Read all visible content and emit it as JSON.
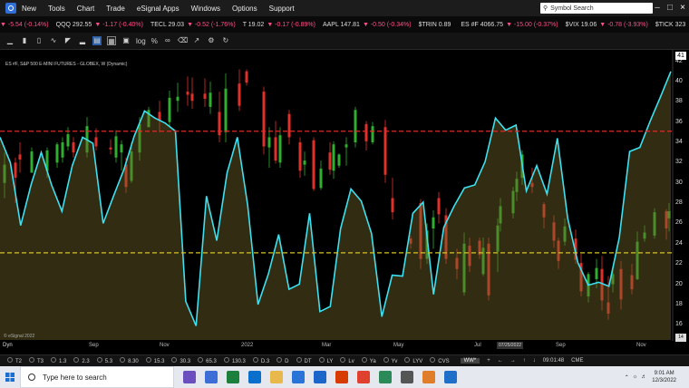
{
  "menubar": {
    "items": [
      "New",
      "Tools",
      "Chart",
      "Trade",
      "eSignal Apps",
      "Windows",
      "Options",
      "Support"
    ],
    "search_placeholder": "Symbol Search"
  },
  "ticker": [
    {
      "sym": "",
      "last": "",
      "chg": "▼ -5.54 (-0.14%)",
      "dir": "neg"
    },
    {
      "sym": "QQQ",
      "last": "292.55",
      "chg": "▼ -1.17 (-0.40%)",
      "dir": "neg"
    },
    {
      "sym": "TECL",
      "last": "29.03",
      "chg": "▼ -0.52 (-1.76%)",
      "dir": "neg"
    },
    {
      "sym": "T",
      "last": "19.02",
      "chg": "▼ -0.17 (-0.89%)",
      "dir": "neg"
    },
    {
      "sym": "AAPL",
      "last": "147.81",
      "chg": "▼ -0.50 (-0.34%)",
      "dir": "neg"
    },
    {
      "sym": "$TRIN",
      "last": "0.89",
      "chg": "",
      "dir": "neg"
    },
    {
      "sym": "ES #F",
      "last": "4066.75",
      "chg": "▼ -15.00 (-0.37%)",
      "dir": "neg"
    },
    {
      "sym": "$VIX",
      "last": "19.06",
      "chg": "▼ -0.78 (-3.93%)",
      "dir": "neg"
    },
    {
      "sym": "$TICK",
      "last": "323",
      "chg": "",
      "dir": "pos"
    },
    {
      "sym": "GUT",
      "last": "7.4",
      "chg": "",
      "dir": "pos"
    }
  ],
  "toolbar": {
    "log_label": "log",
    "pct_label": "%"
  },
  "chart": {
    "title": "ES #F, S&P 500 E-MINI FUTURES - GLOBEX, W (Dynamic)",
    "copyright": "© eSignal 2022",
    "y_ticks": [
      "42",
      "40",
      "38",
      "36",
      "34",
      "32",
      "30",
      "28",
      "26",
      "24",
      "22",
      "20",
      "18",
      "16"
    ],
    "x_labels": [
      "Sep",
      "Nov",
      "2022",
      "Mar",
      "May",
      "Jul",
      "Sep",
      "Nov"
    ],
    "date_tag": "07/25/2022",
    "yval_tag": "41",
    "small_tag": "14",
    "dyn_label": "Dyn",
    "colors": {
      "line": "#3ee0f0",
      "up": "#2fae2f",
      "down": "#e0302a",
      "red_level": "#e02a2a",
      "yellow_level": "#d4c22a"
    }
  },
  "chart_data": {
    "type": "line",
    "ylim": [
      14.5,
      42.5
    ],
    "levels": [
      35.1,
      23.1
    ],
    "cyan_line": [
      34.5,
      32,
      25.8,
      29.8,
      33,
      29.8,
      27.2,
      31.7,
      34.5,
      33.9,
      26,
      28.7,
      31.3,
      34.6,
      37.1,
      36.4,
      35.9,
      35.1,
      18.3,
      15.9,
      28.7,
      24.3,
      31,
      34.5,
      27.8,
      18,
      21,
      24.9,
      19.5,
      20,
      27,
      17.3,
      17.8,
      25.5,
      29.4,
      28.2,
      25,
      16.8,
      20.9,
      20.8,
      27,
      28.1,
      19,
      25.6,
      27.7,
      29.5,
      29.8,
      32.1,
      36.4,
      35.2,
      35.7,
      29.2,
      31.7,
      28.9,
      34.4,
      26.5,
      22.1,
      19.9,
      20.2,
      19.8,
      24.6,
      33.1,
      33.5,
      36.1,
      38.5,
      41
    ],
    "candles": [
      [
        5,
        30,
        33,
        28.5,
        31.8
      ],
      [
        17,
        32,
        32.5,
        28,
        30.5
      ],
      [
        22,
        32.8,
        34,
        31,
        32.3
      ],
      [
        35,
        31,
        33.5,
        31,
        33.1
      ],
      [
        52,
        31.2,
        33.5,
        30.5,
        33.2
      ],
      [
        63,
        32,
        34,
        31.5,
        33.8
      ],
      [
        69,
        32.5,
        34.5,
        32,
        34
      ],
      [
        75,
        33.6,
        35.5,
        33.2,
        34.8
      ],
      [
        81,
        34,
        34.5,
        32.5,
        33
      ],
      [
        96,
        33,
        36.5,
        32.5,
        35.6
      ],
      [
        106,
        34.5,
        35.4,
        33.2,
        33.6
      ],
      [
        122,
        33.5,
        34.3,
        32.8,
        33.3
      ],
      [
        128,
        32.5,
        35.2,
        32,
        34.6
      ],
      [
        134,
        33,
        34.2,
        31.2,
        33.8
      ],
      [
        139,
        31.8,
        32.5,
        29,
        29.6
      ],
      [
        145,
        30.2,
        34,
        30,
        33.1
      ],
      [
        154,
        33,
        36.5,
        32.2,
        35.8
      ],
      [
        164,
        35.5,
        37.5,
        35.5,
        37.2
      ],
      [
        176,
        37,
        38.1,
        35,
        36.2
      ],
      [
        187,
        36,
        39.1,
        35.5,
        38.4
      ],
      [
        196,
        38.1,
        39.9,
        37,
        38.5
      ],
      [
        207,
        39,
        40.5,
        37.6,
        38.7
      ],
      [
        212,
        38.8,
        40.4,
        37.3,
        38.1
      ],
      [
        226,
        38.8,
        40.3,
        37.5,
        38.3
      ],
      [
        232,
        37.5,
        40,
        36.8,
        38.9
      ],
      [
        242,
        37,
        39,
        34,
        34.7
      ],
      [
        249,
        35,
        40.8,
        34,
        39.3
      ],
      [
        264,
        39.8,
        41.2,
        37.1,
        37.6
      ],
      [
        272,
        41,
        41.2,
        39.6,
        39.9
      ],
      [
        291,
        39,
        39.5,
        32.8,
        33.6
      ],
      [
        297,
        33.5,
        35.5,
        31.5,
        34.5
      ],
      [
        304,
        34.5,
        36.1,
        31.9,
        32.2
      ],
      [
        309,
        32,
        35.5,
        31.5,
        34.7
      ],
      [
        319,
        36.8,
        37.2,
        33.8,
        34.5
      ],
      [
        331,
        34,
        34.5,
        30.5,
        31.2
      ],
      [
        336,
        31.8,
        33.1,
        30.7,
        32.2
      ],
      [
        346,
        34.2,
        34.5,
        29.2,
        29.4
      ],
      [
        354,
        29.5,
        32.2,
        29.3,
        31.4
      ],
      [
        364,
        33,
        34,
        30.8,
        31.3
      ],
      [
        368,
        31.2,
        34.1,
        30.4,
        33.8
      ],
      [
        374,
        31.7,
        32.9,
        31.5,
        32.8
      ],
      [
        382,
        33.5,
        34.5,
        31.7,
        33.8
      ],
      [
        392,
        34,
        37.5,
        33.5,
        37.2
      ],
      [
        404,
        35.8,
        36.1,
        33.2,
        34.1
      ],
      [
        411,
        34,
        36,
        33.8,
        35.6
      ],
      [
        425,
        35.5,
        36.2,
        30,
        30.8
      ],
      [
        433,
        28.5,
        30.5,
        26.4,
        27.1
      ],
      [
        453,
        24.5,
        24.8,
        23.5,
        24
      ],
      [
        464,
        28,
        28.4,
        21.5,
        22.5
      ],
      [
        471,
        22.5,
        26,
        22,
        25.3
      ],
      [
        478,
        25.5,
        27.3,
        23.5,
        26.6
      ],
      [
        484,
        28.5,
        29.1,
        26,
        26.9
      ],
      [
        492,
        26.8,
        27.5,
        22,
        22.5
      ],
      [
        504,
        22.6,
        23.5,
        20.5,
        21.5
      ],
      [
        512,
        19.2,
        25.1,
        18.9,
        24
      ],
      [
        518,
        23.8,
        24.6,
        21.2,
        21.8
      ],
      [
        529,
        24.3,
        24.6,
        22.5,
        22.9
      ],
      [
        533,
        21,
        24.6,
        20.8,
        23.6
      ],
      [
        539,
        24,
        24.6,
        18.4,
        18.9
      ],
      [
        549,
        23.2,
        26.5,
        21.2,
        25.8
      ],
      [
        552,
        26,
        28.5,
        25.2,
        27.7
      ],
      [
        566,
        27,
        29.6,
        26.5,
        29.2
      ],
      [
        570,
        29.1,
        31.1,
        28.2,
        30.4
      ],
      [
        576,
        30.5,
        33.2,
        29.8,
        32.8
      ],
      [
        587,
        30,
        31.5,
        29,
        29.6
      ],
      [
        600,
        27.9,
        28.1,
        25.5,
        26.6
      ],
      [
        611,
        26.1,
        26.8,
        23.6,
        24.3
      ],
      [
        616,
        24.3,
        24.6,
        21.5,
        22.3
      ],
      [
        623,
        24.2,
        26.5,
        23.8,
        25.7
      ],
      [
        635,
        24.5,
        25.4,
        22,
        22.4
      ],
      [
        641,
        22.1,
        23,
        18.8,
        19.3
      ],
      [
        649,
        18.8,
        21.2,
        18.2,
        21
      ],
      [
        658,
        20.5,
        22.5,
        19.6,
        21.6
      ],
      [
        664,
        21.5,
        22.8,
        17.4,
        18.4
      ],
      [
        671,
        18.2,
        20.8,
        16.5,
        17.1
      ],
      [
        676,
        20,
        21.5,
        19.2,
        21
      ],
      [
        685,
        21.5,
        22.3,
        17.5,
        18.5
      ],
      [
        697,
        20.9,
        22,
        19,
        19.5
      ],
      [
        703,
        20.5,
        25.2,
        20.4,
        24.2
      ],
      [
        711,
        24.5,
        25.8,
        24.2,
        25.1
      ],
      [
        722,
        24.8,
        27.5,
        24.5,
        27.1
      ],
      [
        735,
        27.2,
        27.4,
        24.4,
        25.5
      ],
      [
        738,
        26.5,
        28,
        25.2,
        27.2
      ]
    ]
  },
  "bottom": {
    "intervals": [
      "T2",
      "T3",
      "1.3",
      "2.3",
      "5.3",
      "8.30",
      "15.3",
      "30.3",
      "65.3",
      "130.3",
      "D.3",
      "D",
      "DT",
      "LY",
      "Lv",
      "Ya",
      "Yv",
      "LYV",
      "CVS"
    ],
    "ww_tab": "WW*",
    "time": "09:01:48",
    "mode": "CME"
  },
  "taskbar": {
    "search_placeholder": "Type here to search",
    "clock_time": "9:01 AM",
    "clock_date": "12/3/2022"
  }
}
